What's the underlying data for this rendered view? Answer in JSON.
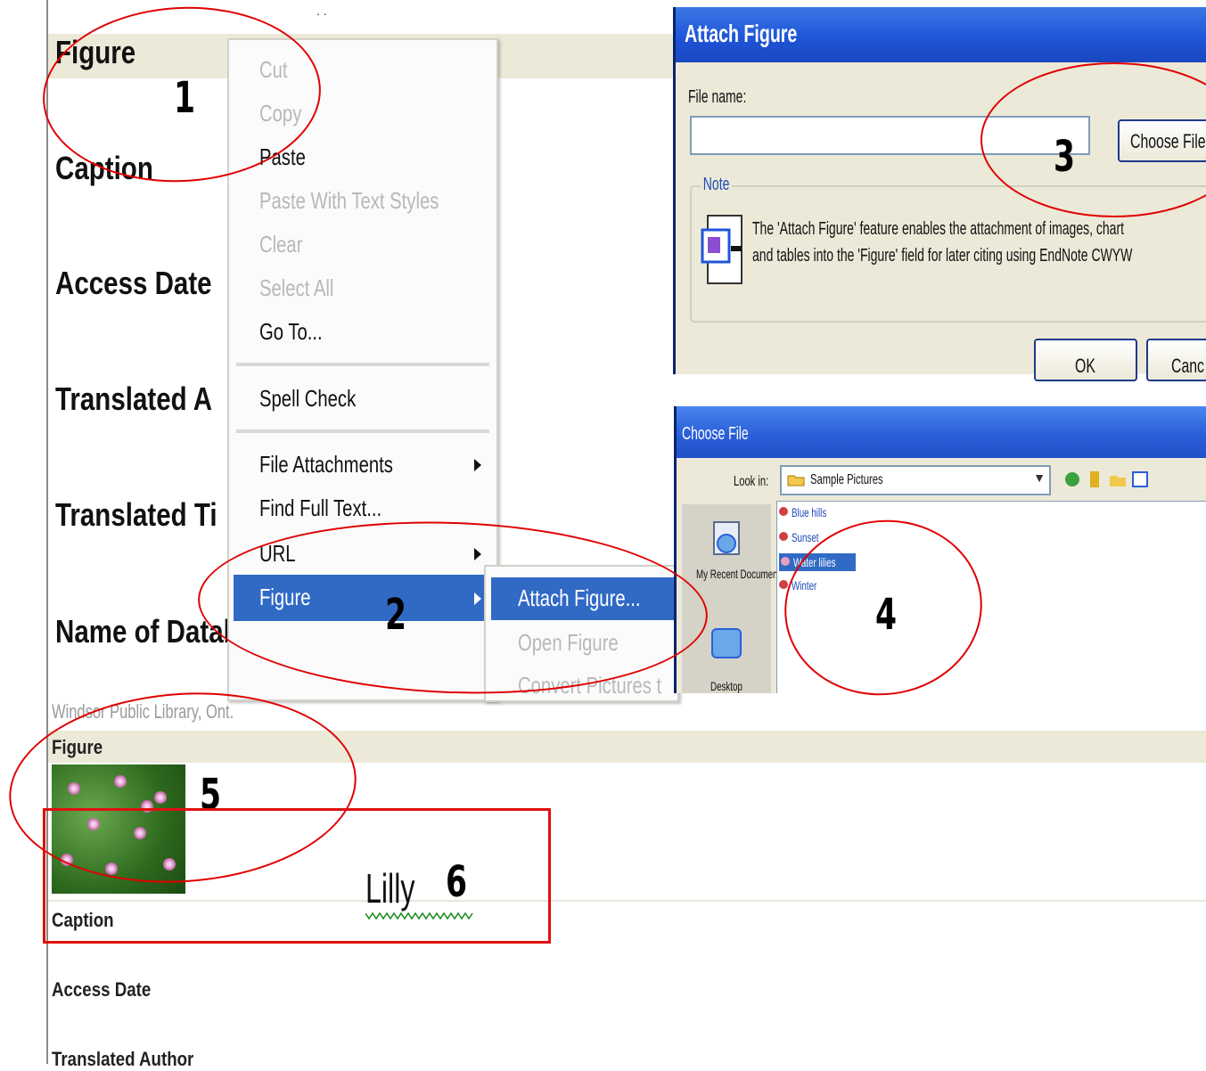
{
  "left_panel": {
    "top_dots": "..",
    "fields_large": [
      "Figure",
      "Caption",
      "Access Date",
      "Translated A",
      "Translated Ti",
      "Name of Database"
    ],
    "source_text": "Windsor Public Library, Ont.",
    "fields_small": [
      "Figure",
      "Caption",
      "Access Date",
      "Translated Author"
    ],
    "caption_value": "Lilly"
  },
  "context_menu": {
    "items": [
      {
        "label": "Cut",
        "enabled": false
      },
      {
        "label": "Copy",
        "enabled": false
      },
      {
        "label": "Paste",
        "enabled": true
      },
      {
        "label": "Paste With Text Styles",
        "enabled": false
      },
      {
        "label": "Clear",
        "enabled": false
      },
      {
        "label": "Select All",
        "enabled": false
      },
      {
        "label": "Go To...",
        "enabled": true
      },
      {
        "label": "Spell Check",
        "enabled": true
      },
      {
        "label": "File Attachments",
        "enabled": true,
        "submenu": true
      },
      {
        "label": "Find Full Text...",
        "enabled": true
      },
      {
        "label": "URL",
        "enabled": true,
        "submenu": true
      },
      {
        "label": "Figure",
        "enabled": true,
        "submenu": true,
        "highlighted": true
      }
    ],
    "submenu": [
      {
        "label": "Attach Figure...",
        "highlighted": true
      },
      {
        "label": "Open Figure",
        "enabled": false
      },
      {
        "label": "Convert Pictures t",
        "enabled": false
      }
    ]
  },
  "attach_dialog": {
    "title": "Attach Figure",
    "file_name_label": "File name:",
    "file_name_value": "",
    "choose_button": "Choose File",
    "note_label": "Note",
    "note_line1": "The 'Attach Figure' feature enables the attachment of images, chart",
    "note_line2": "and tables into the 'Figure' field for later citing using EndNote CWYW",
    "ok_button": "OK",
    "cancel_button": "Canc"
  },
  "choose_dialog": {
    "title": "Choose File",
    "look_in_label": "Look in:",
    "look_in_value": "Sample Pictures",
    "places": [
      "My Recent Documents",
      "Desktop"
    ],
    "files": [
      {
        "name": "Blue hills",
        "selected": false
      },
      {
        "name": "Sunset",
        "selected": false
      },
      {
        "name": "Water lilies",
        "selected": true
      },
      {
        "name": "Winter",
        "selected": false
      }
    ]
  },
  "annotations": [
    "1",
    "2",
    "3",
    "4",
    "5",
    "6"
  ],
  "colors": {
    "annotation_red": "#e00000",
    "menu_highlight": "#316ac5",
    "xp_title_blue": "#1f55d8",
    "dialog_face": "#ece9d8"
  }
}
